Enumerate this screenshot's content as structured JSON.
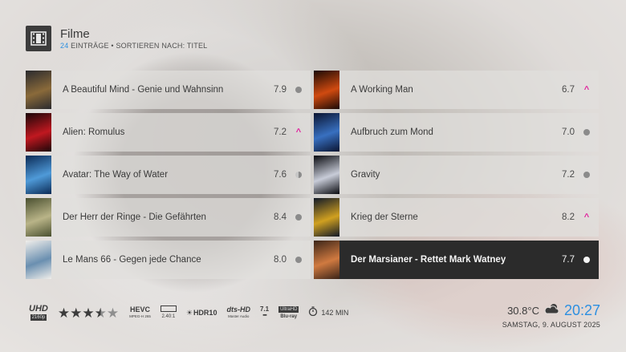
{
  "header": {
    "title": "Filme",
    "count": "24",
    "subtitle_rest": " EINTRÄGE  •  SORTIEREN NACH: TITEL"
  },
  "movies_left": [
    {
      "title": "A Beautiful Mind - Genie und Wahnsinn",
      "rating": "7.9",
      "status": "dot"
    },
    {
      "title": "Alien: Romulus",
      "rating": "7.2",
      "status": "caret"
    },
    {
      "title": "Avatar: The Way of Water",
      "rating": "7.6",
      "status": "half"
    },
    {
      "title": "Der Herr der Ringe - Die Gefährten",
      "rating": "8.4",
      "status": "dot"
    },
    {
      "title": "Le Mans 66 - Gegen jede Chance",
      "rating": "8.0",
      "status": "dot"
    }
  ],
  "movies_right": [
    {
      "title": "A Working Man",
      "rating": "6.7",
      "status": "caret"
    },
    {
      "title": "Aufbruch zum Mond",
      "rating": "7.0",
      "status": "dot"
    },
    {
      "title": "Gravity",
      "rating": "7.2",
      "status": "dot"
    },
    {
      "title": "Krieg der Sterne",
      "rating": "8.2",
      "status": "caret"
    },
    {
      "title": "Der Marsianer - Rettet Mark Watney",
      "rating": "7.7",
      "status": "dot",
      "selected": true
    }
  ],
  "status_glyph": {
    "caret": "^"
  },
  "footer": {
    "uhd_top": "UHD",
    "uhd_bottom": "2160p",
    "stars_filled": 3.5,
    "stars_total": 5,
    "hevc_top": "HEVC",
    "hevc_bottom": "MPEG-H 265",
    "aspect": "2.40:1",
    "hdr": "HDR10",
    "dts_top": "dts-HD",
    "dts_bottom": "Master Audio",
    "channels": "7.1",
    "bluray_top": "UltraHD",
    "bluray_bottom": "Blu-ray",
    "runtime": "142 MIN"
  },
  "clock": {
    "temperature": "30.8°C",
    "time": "20:27",
    "date": "SAMSTAG, 9. AUGUST 2025"
  },
  "colors": {
    "accent": "#2d8fe0",
    "caret": "#e0209c",
    "selected_bg": "#2b2b2b"
  }
}
